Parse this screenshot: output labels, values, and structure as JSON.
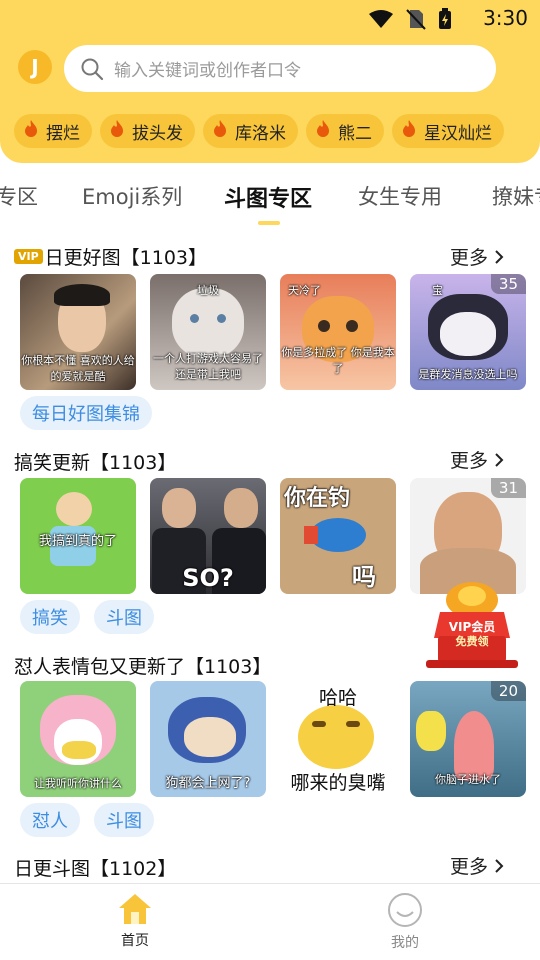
{
  "status": {
    "time": "3:30"
  },
  "search": {
    "placeholder": "输入关键词或创作者口令"
  },
  "hot_tags": [
    "摆烂",
    "拔头发",
    "库洛米",
    "熊二",
    "星汉灿烂"
  ],
  "tabs": [
    "专区",
    "Emoji系列",
    "斗图专区",
    "女生专用",
    "撩妹专"
  ],
  "active_tab": "斗图专区",
  "more_label": "更多",
  "sections": [
    {
      "title": "日更好图【1103】",
      "vip": "VIP",
      "thumbs": [
        {
          "caption": "你根本不懂 喜欢的人给的爱就是酷",
          "badge": ""
        },
        {
          "caption": "一个人打游戏太容易了 还是带上我吧",
          "top": "垃圾",
          "badge": ""
        },
        {
          "caption": "你是多拉成了 你是我本了",
          "top": "天冷了",
          "badge": ""
        },
        {
          "caption": "是群发消息没选上吗",
          "top": "宝",
          "badge": "35"
        }
      ],
      "tags": [
        "每日好图集锦"
      ]
    },
    {
      "title": "搞笑更新【1103】",
      "thumbs": [
        {
          "caption": "我搞到真的了",
          "badge": ""
        },
        {
          "caption": "SO?",
          "badge": ""
        },
        {
          "caption": "吗",
          "top": "你在钓",
          "badge": ""
        },
        {
          "caption": "",
          "badge": "31"
        }
      ],
      "tags": [
        "搞笑",
        "斗图"
      ]
    },
    {
      "title": "怼人表情包又更新了【1103】",
      "thumbs": [
        {
          "caption": "让我听听你讲什么",
          "badge": ""
        },
        {
          "caption": "狗都会上网了?",
          "badge": ""
        },
        {
          "caption": "哪来的臭嘴",
          "top": "哈哈",
          "badge": ""
        },
        {
          "caption": "你脑子进水了",
          "badge": "20"
        }
      ],
      "tags": [
        "怼人",
        "斗图"
      ]
    },
    {
      "title": "日更斗图【1102】",
      "thumbs": [],
      "tags": []
    }
  ],
  "vip_float": {
    "line1": "VIP会员",
    "line2": "免费领"
  },
  "bottom_nav": [
    {
      "label": "首页",
      "icon": "home-icon",
      "active": true
    },
    {
      "label": "我的",
      "icon": "smiley-icon",
      "active": false
    }
  ],
  "colors": {
    "brand": "#fdd85c",
    "chip": "#f8c53a",
    "tag_bg": "#e6f1fb",
    "tag_text": "#3d8de0"
  }
}
